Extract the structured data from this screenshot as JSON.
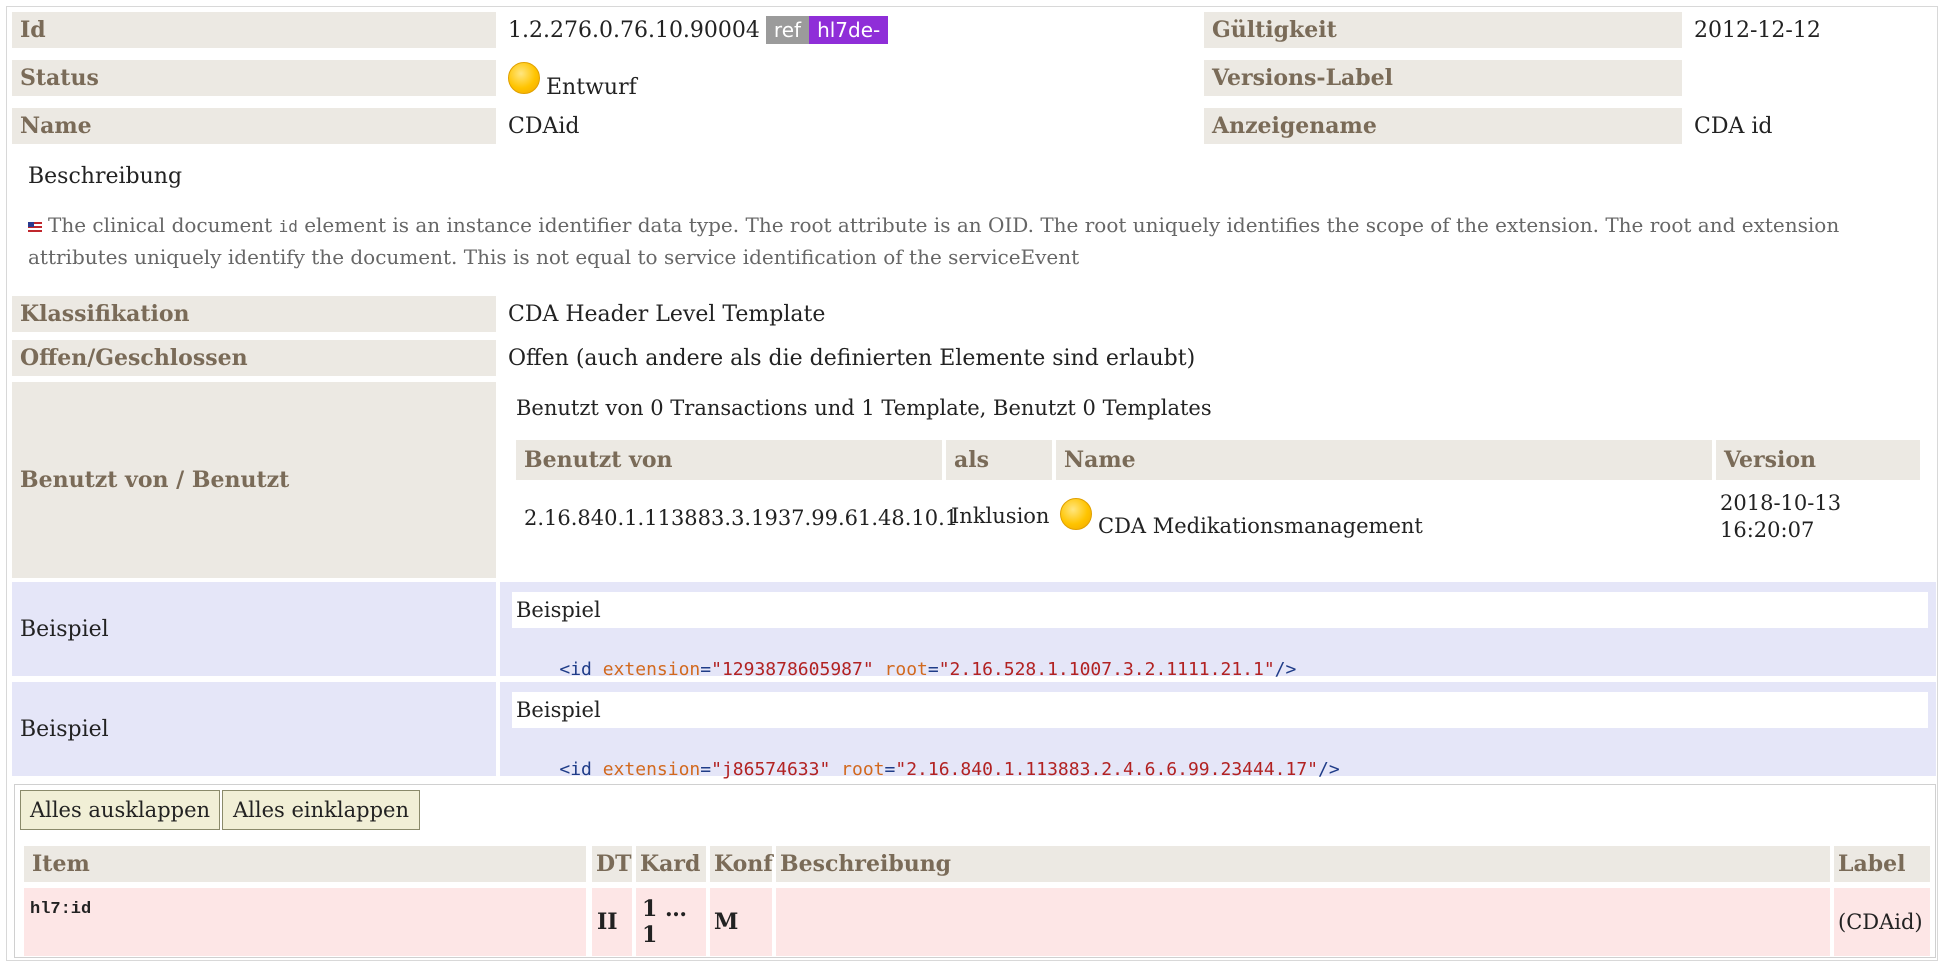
{
  "meta": {
    "id_label": "Id",
    "id_value": "1.2.276.0.76.10.90004",
    "ref_badge": "ref",
    "prefix_badge": "hl7de-",
    "gueltigkeit_label": "Gültigkeit",
    "gueltigkeit_value": "2012-12-12",
    "status_label": "Status",
    "status_value": "Entwurf",
    "versions_label": "Versions-Label",
    "name_label": "Name",
    "name_value": "CDAid",
    "anzeigename_label": "Anzeigename",
    "anzeigename_value": "CDA id"
  },
  "description": {
    "heading": "Beschreibung",
    "text_before": "The clinical document",
    "code_word": "id",
    "text_after": "element is an instance identifier data type. The root attribute is an OID. The root uniquely identifies the scope of the extension. The root and extension",
    "text_line2": "attributes uniquely identify the document. This is not equal to service identification of the serviceEvent"
  },
  "classification": {
    "klassifikation_label": "Klassifikation",
    "klassifikation_value": "CDA Header Level Template",
    "offen_label": "Offen/Geschlossen",
    "offen_value": "Offen (auch andere als die definierten Elemente sind erlaubt)"
  },
  "usage": {
    "label": "Benutzt von / Benutzt",
    "summary": "Benutzt von 0 Transactions und 1 Template, Benutzt 0 Templates",
    "columns": [
      "Benutzt von",
      "als",
      "Name",
      "Version"
    ],
    "row": {
      "benutzt_von": "2.16.840.1.113883.3.1937.99.61.48.10.1",
      "als": "Inklusion",
      "name": "CDA Medikationsmanagement",
      "version_line1": "2018-10-13",
      "version_line2": "16:20:07"
    }
  },
  "examples": [
    {
      "label": "Beispiel",
      "title": "Beispiel",
      "open": "<id ",
      "attr1": "extension",
      "val1": "\"1293878605987\"",
      "attr2": "root",
      "val2": "\"2.16.528.1.1007.3.2.1111.21.1\"",
      "close": "/>"
    },
    {
      "label": "Beispiel",
      "title": "Beispiel",
      "open": "<id ",
      "attr1": "extension",
      "val1": "\"j86574633\"",
      "attr2": "root",
      "val2": "\"2.16.840.1.113883.2.4.6.6.99.23444.17\"",
      "close": "/>"
    }
  ],
  "buttons": {
    "expand_all": "Alles ausklappen",
    "collapse_all": "Alles einklappen"
  },
  "items_table": {
    "columns": [
      "Item",
      "DT",
      "Kard",
      "Konf",
      "Beschreibung",
      "Label"
    ],
    "row": {
      "item": "hl7:id",
      "dt": "II",
      "kard": "1 … 1",
      "konf": "M",
      "beschreibung": "",
      "label": "(CDAid)"
    }
  }
}
